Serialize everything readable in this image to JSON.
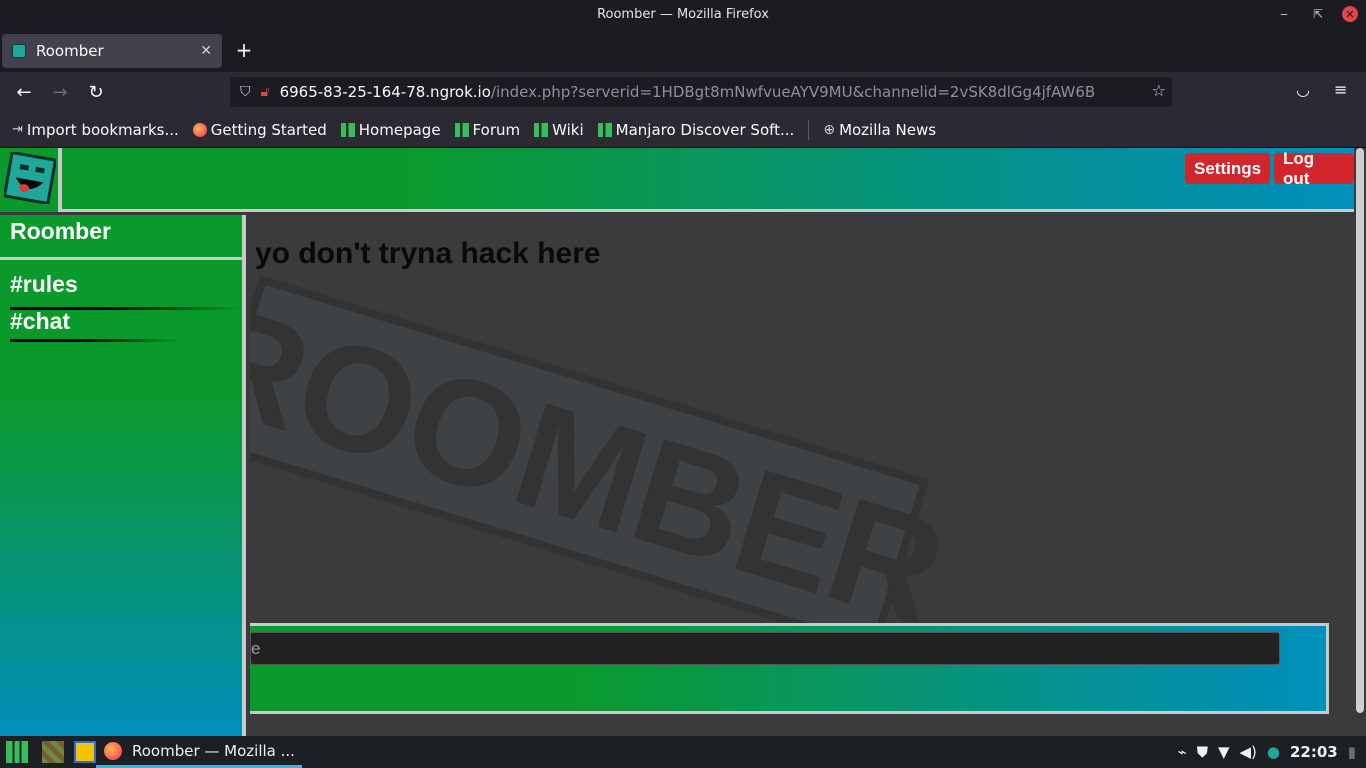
{
  "window": {
    "title": "Roomber — Mozilla Firefox",
    "min_glyph": "‒",
    "max_glyph": "⇱",
    "close_glyph": "✕"
  },
  "tabs": [
    {
      "label": "Roomber",
      "close": "✕"
    }
  ],
  "newtab_glyph": "+",
  "nav": {
    "back": "←",
    "forward": "→",
    "reload": "↻",
    "url_host": "6965-83-25-164-78.ngrok.io",
    "url_rest": "/index.php?serverid=1HDBgt8mNwfvueAYV9MU&channelid=2vSK8dlGg4jfAW6B",
    "star": "☆",
    "pocket": "◡",
    "menu": "≡"
  },
  "bookmarks": [
    {
      "label": "Import bookmarks...",
      "icon": "import-icon"
    },
    {
      "label": "Getting Started",
      "icon": "firefox-icon"
    },
    {
      "label": "Homepage",
      "icon": "manjaro-icon"
    },
    {
      "label": "Forum",
      "icon": "manjaro-icon"
    },
    {
      "label": "Wiki",
      "icon": "manjaro-icon"
    },
    {
      "label": "Manjaro Discover Soft...",
      "icon": "manjaro-icon"
    },
    {
      "label": "Mozilla News",
      "icon": "globe-icon"
    }
  ],
  "app": {
    "header": {
      "settings_label": "Settings",
      "logout_label": "Log out"
    },
    "server_name": "Roomber",
    "channels": [
      {
        "label": "#rules"
      },
      {
        "label": "#chat"
      }
    ],
    "messages": [
      {
        "text": "yo don't tryna hack here"
      }
    ],
    "watermark_text": "ROOMBER",
    "composer": {
      "value": "e"
    },
    "colors": {
      "accent_green": "#0a9a2c",
      "accent_blue": "#0090bb",
      "button_red": "#d1262b"
    }
  },
  "taskbar": {
    "task_label": "Roomber — Mozilla ...",
    "clock": "22:03"
  }
}
